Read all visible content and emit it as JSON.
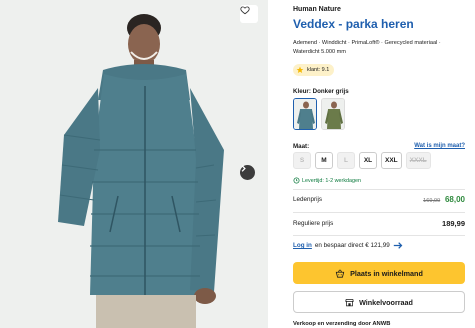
{
  "product": {
    "brand": "Human Nature",
    "title": "Veddex - parka heren",
    "specs": "Ademend · Winddicht · PrimaLoft® · Gerecycled materiaal · Waterdicht 5.000 mm",
    "rating_label": "klant: 9.1"
  },
  "gallery": {
    "favorite_icon": "heart-icon",
    "next_icon": "chevron-right-icon"
  },
  "color": {
    "label": "Kleur: Donker grijs",
    "swatches": [
      "Donker grijs",
      "Groen"
    ]
  },
  "size": {
    "label": "Maat:",
    "guide_link": "Wat is mijn maat?",
    "options": [
      {
        "label": "S",
        "available": false,
        "strike": false
      },
      {
        "label": "M",
        "available": true,
        "strike": false
      },
      {
        "label": "L",
        "available": false,
        "strike": false
      },
      {
        "label": "XL",
        "available": true,
        "strike": false
      },
      {
        "label": "XXL",
        "available": true,
        "strike": false
      },
      {
        "label": "XXXL",
        "available": false,
        "strike": true
      }
    ]
  },
  "delivery": "Levertijd: 1-2 werkdagen",
  "pricing": {
    "member_label": "Ledenprijs",
    "old_price": "169,99",
    "member_price": "68,00",
    "regular_label": "Reguliere prijs",
    "regular_price": "189,99"
  },
  "login": {
    "link": "Log in",
    "text": "en bespaar direct € 121,99"
  },
  "actions": {
    "cart_label": "Plaats in winkelmand",
    "store_label": "Winkelvoorraad"
  },
  "shipping_label": "Verkoop en verzending door ANWB",
  "colors": {
    "accent_blue": "#1f5fae",
    "cta_yellow": "#fdc52f",
    "member_green": "#2f8a3e",
    "jacket": "#4f7f8d"
  }
}
